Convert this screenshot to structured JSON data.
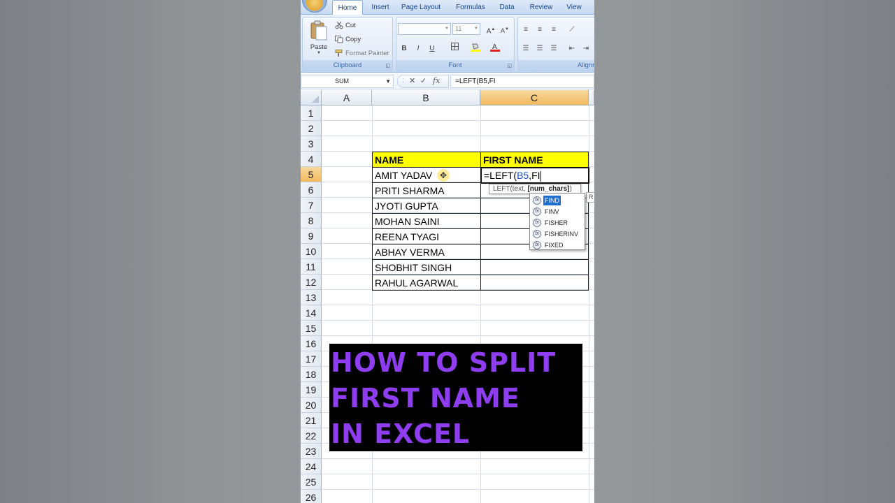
{
  "ribbon": {
    "tabs": [
      {
        "label": "Home",
        "active": true
      },
      {
        "label": "Insert",
        "active": false
      },
      {
        "label": "Page Layout",
        "active": false
      },
      {
        "label": "Formulas",
        "active": false
      },
      {
        "label": "Data",
        "active": false
      },
      {
        "label": "Review",
        "active": false
      },
      {
        "label": "View",
        "active": false
      }
    ],
    "clipboard": {
      "label": "Clipboard",
      "paste": "Paste",
      "cut": "Cut",
      "copy": "Copy",
      "format_painter": "Format Painter"
    },
    "font": {
      "label": "Font",
      "font_name": "",
      "font_size": "11",
      "bold": "B",
      "italic": "I",
      "underline": "U"
    },
    "alignment": {
      "label": "Alignm"
    }
  },
  "formula_bar": {
    "name_box": "SUM",
    "formula": "=LEFT(B5,FI"
  },
  "sheet": {
    "columns": [
      "A",
      "B",
      "C"
    ],
    "selected_column": "C",
    "rows": [
      "1",
      "2",
      "3",
      "4",
      "5",
      "6",
      "7",
      "8",
      "9",
      "10",
      "11",
      "12",
      "13",
      "14",
      "15",
      "16",
      "17",
      "18",
      "19",
      "20",
      "21",
      "22",
      "23",
      "24",
      "25",
      "26"
    ],
    "selected_row": "5",
    "table": {
      "header_name": "NAME",
      "header_first_name": "FIRST NAME",
      "names": [
        "AMIT YADAV",
        "PRITI SHARMA",
        "JYOTI GUPTA",
        "MOHAN SAINI",
        "REENA TYAGI",
        "ABHAY VERMA",
        "SHOBHIT SINGH",
        "RAHUL AGARWAL"
      ]
    },
    "editing_cell": {
      "prefix": "=LEFT(",
      "ref": "B5",
      "suffix": ",FI",
      "ref_color": "#1f4fbf"
    }
  },
  "tooltip": {
    "prefix": "LEFT(text, ",
    "bold_arg": "[num_chars]",
    "suffix": ")"
  },
  "autocomplete": {
    "items": [
      "FIND",
      "FINV",
      "FISHER",
      "FISHERINV",
      "FIXED"
    ],
    "selected": "FIND",
    "icon_label": "fx"
  },
  "peek_tip": "R",
  "overlay": {
    "lines": [
      "HOW TO SPLIT",
      "FIRST NAME",
      "IN EXCEL"
    ],
    "text_color": "#8f3df0",
    "background": "#000000"
  }
}
